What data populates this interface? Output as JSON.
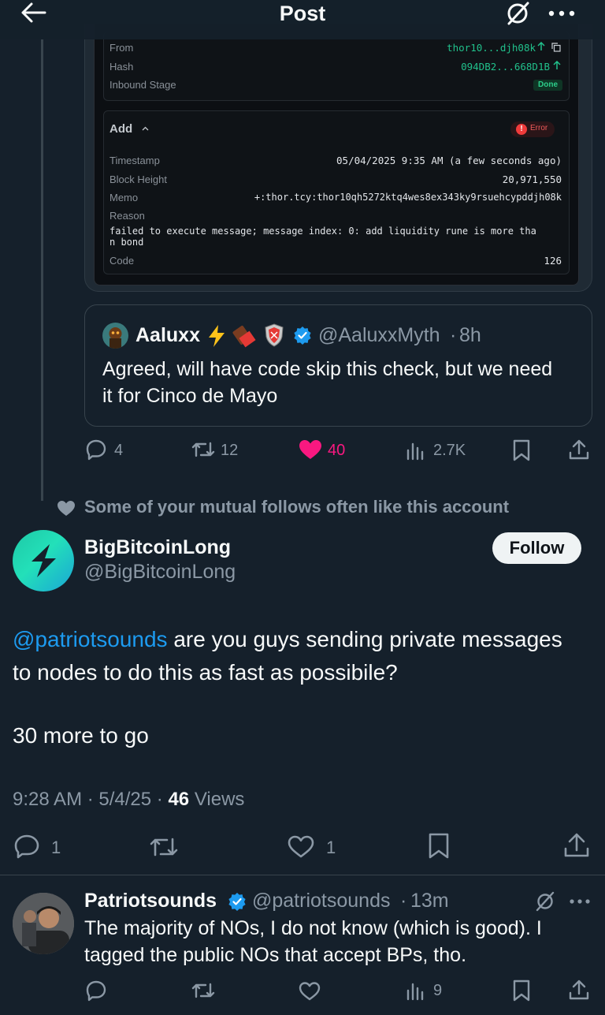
{
  "header": {
    "title": "Post"
  },
  "screenshot": {
    "from_label": "From",
    "from_value": "thor10...djh08k",
    "hash_label": "Hash",
    "hash_value": "094DB2...668D1B",
    "inbound_label": "Inbound Stage",
    "inbound_status": "Done",
    "add_title": "Add",
    "error_label": "Error",
    "timestamp_label": "Timestamp",
    "timestamp_value": "05/04/2025 9:35 AM (a few seconds ago)",
    "block_label": "Block Height",
    "block_value": "20,971,550",
    "memo_label": "Memo",
    "memo_value": "+:thor.tcy:thor10qh5272ktq4wes8ex343ky9rsuehcypddjh08k",
    "reason_label": "Reason",
    "reason_line1": "failed to execute message; message index: 0: add liquidity rune is more tha",
    "reason_line2": "n bond",
    "code_label": "Code",
    "code_value": "126"
  },
  "quote": {
    "name": "Aaluxx",
    "handle": "@AaluxxMyth",
    "time": "8h",
    "text_line1": "Agreed, will have code skip this check, but we need",
    "text_line2": "it for Cinco de Mayo"
  },
  "parent_actions": {
    "replies": "4",
    "reposts": "12",
    "likes": "40",
    "views": "2.7K"
  },
  "social_context": "Some of your mutual follows often like this account",
  "main_post": {
    "name": "BigBitcoinLong",
    "handle": "@BigBitcoinLong",
    "follow_label": "Follow",
    "mention": "@patriotsounds",
    "text_line1": " are you guys sending private messages",
    "text_line2": "to nodes to do this as fast as possibile?",
    "text_line3": "30 more to go",
    "time": "9:28 AM",
    "date": "5/4/25",
    "views_count": "46",
    "views_label": "Views",
    "replies": "1",
    "likes": "1"
  },
  "reply": {
    "name": "Patriotsounds",
    "handle": "@patriotsounds",
    "time": "13m",
    "text_line1": "The majority of NOs, I do not know (which is good). I",
    "text_line2": "tagged the public NOs that accept BPs, tho.",
    "views": "9"
  },
  "colors": {
    "background": "#15202b",
    "accent": "#1d9bf0",
    "like_pink": "#f91880",
    "muted": "#8b98a5",
    "follow_bg": "#eff3f4"
  }
}
